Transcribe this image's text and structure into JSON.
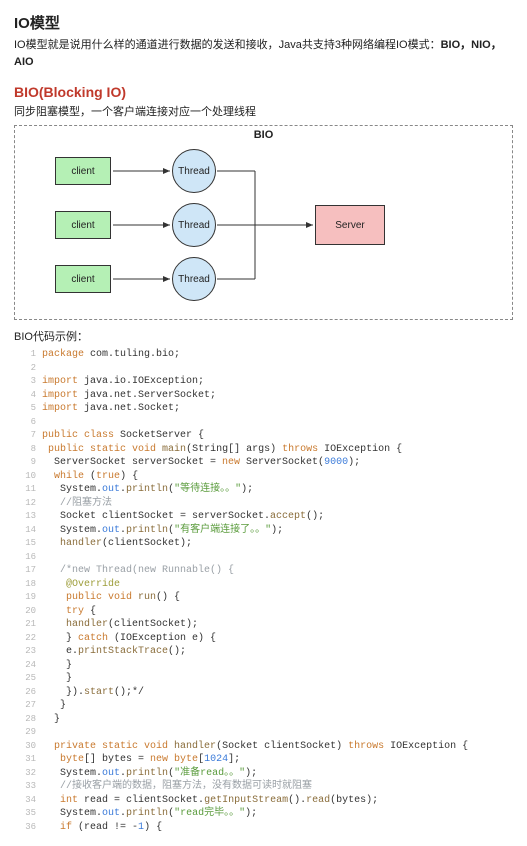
{
  "heading_io": "IO模型",
  "intro_pre": "IO模型就是说用什么样的通道进行数据的发送和接收，Java共支持3种网络编程IO模式：",
  "intro_bold": "BIO，NIO，AIO",
  "heading_bio": "BIO(Blocking IO)",
  "bio_desc": "同步阻塞模型，一个客户端连接对应一个处理线程",
  "diagram": {
    "title": "BIO",
    "client": "client",
    "thread": "Thread",
    "server": "Server"
  },
  "code_caption": "BIO代码示例：",
  "code": [
    {
      "n": 1,
      "seg": [
        {
          "c": "kw",
          "t": "package"
        },
        {
          "t": " com.tuling.bio;"
        }
      ]
    },
    {
      "n": 2,
      "seg": []
    },
    {
      "n": 3,
      "seg": [
        {
          "c": "kw",
          "t": "import"
        },
        {
          "t": " java.io.IOException;"
        }
      ]
    },
    {
      "n": 4,
      "seg": [
        {
          "c": "kw",
          "t": "import"
        },
        {
          "t": " java.net.ServerSocket;"
        }
      ]
    },
    {
      "n": 5,
      "seg": [
        {
          "c": "kw",
          "t": "import"
        },
        {
          "t": " java.net.Socket;"
        }
      ]
    },
    {
      "n": 6,
      "seg": []
    },
    {
      "n": 7,
      "seg": [
        {
          "c": "kw",
          "t": "public class "
        },
        {
          "c": "cls",
          "t": "SocketServer"
        },
        {
          "t": " {"
        }
      ]
    },
    {
      "n": 8,
      "seg": [
        {
          "t": " "
        },
        {
          "c": "kw",
          "t": "public static void "
        },
        {
          "c": "meth",
          "t": "main"
        },
        {
          "t": "(String[] args) "
        },
        {
          "c": "kw",
          "t": "throws"
        },
        {
          "t": " IOException {"
        }
      ]
    },
    {
      "n": 9,
      "seg": [
        {
          "t": "  ServerSocket serverSocket = "
        },
        {
          "c": "kw",
          "t": "new"
        },
        {
          "t": " ServerSocket("
        },
        {
          "c": "num",
          "t": "9000"
        },
        {
          "t": ");"
        }
      ]
    },
    {
      "n": 10,
      "seg": [
        {
          "t": "  "
        },
        {
          "c": "kw",
          "t": "while"
        },
        {
          "t": " ("
        },
        {
          "c": "kw",
          "t": "true"
        },
        {
          "t": ") {"
        }
      ]
    },
    {
      "n": 11,
      "seg": [
        {
          "t": "   System."
        },
        {
          "c": "blue",
          "t": "out"
        },
        {
          "t": "."
        },
        {
          "c": "meth",
          "t": "println"
        },
        {
          "t": "("
        },
        {
          "c": "str",
          "t": "\"等待连接。。\""
        },
        {
          "t": ");"
        }
      ]
    },
    {
      "n": 12,
      "seg": [
        {
          "t": "   "
        },
        {
          "c": "cmt",
          "t": "//阻塞方法"
        }
      ]
    },
    {
      "n": 13,
      "seg": [
        {
          "t": "   Socket clientSocket = serverSocket."
        },
        {
          "c": "meth",
          "t": "accept"
        },
        {
          "t": "();"
        }
      ]
    },
    {
      "n": 14,
      "seg": [
        {
          "t": "   System."
        },
        {
          "c": "blue",
          "t": "out"
        },
        {
          "t": "."
        },
        {
          "c": "meth",
          "t": "println"
        },
        {
          "t": "("
        },
        {
          "c": "str",
          "t": "\"有客户端连接了。。\""
        },
        {
          "t": ");"
        }
      ]
    },
    {
      "n": 15,
      "seg": [
        {
          "t": "   "
        },
        {
          "c": "meth",
          "t": "handler"
        },
        {
          "t": "(clientSocket);"
        }
      ]
    },
    {
      "n": 16,
      "seg": []
    },
    {
      "n": 17,
      "seg": [
        {
          "t": "   "
        },
        {
          "c": "cmt",
          "t": "/*new Thread(new Runnable() {"
        }
      ]
    },
    {
      "n": 18,
      "seg": [
        {
          "t": "    "
        },
        {
          "c": "ann",
          "t": "@Override"
        }
      ]
    },
    {
      "n": 19,
      "seg": [
        {
          "t": "    "
        },
        {
          "c": "kw",
          "t": "public void "
        },
        {
          "c": "meth",
          "t": "run"
        },
        {
          "t": "() {"
        }
      ]
    },
    {
      "n": 20,
      "seg": [
        {
          "t": "    "
        },
        {
          "c": "kw",
          "t": "try"
        },
        {
          "t": " {"
        }
      ]
    },
    {
      "n": 21,
      "seg": [
        {
          "t": "    "
        },
        {
          "c": "meth",
          "t": "handler"
        },
        {
          "t": "(clientSocket);"
        }
      ]
    },
    {
      "n": 22,
      "seg": [
        {
          "t": "    } "
        },
        {
          "c": "kw",
          "t": "catch"
        },
        {
          "t": " (IOException e) {"
        }
      ]
    },
    {
      "n": 23,
      "seg": [
        {
          "t": "    e."
        },
        {
          "c": "meth",
          "t": "printStackTrace"
        },
        {
          "t": "();"
        }
      ]
    },
    {
      "n": 24,
      "seg": [
        {
          "t": "    }"
        }
      ]
    },
    {
      "n": 25,
      "seg": [
        {
          "t": "    }"
        }
      ]
    },
    {
      "n": 26,
      "seg": [
        {
          "t": "    })."
        },
        {
          "c": "meth",
          "t": "start"
        },
        {
          "t": "();*/"
        }
      ]
    },
    {
      "n": 27,
      "seg": [
        {
          "t": "   }"
        }
      ]
    },
    {
      "n": 28,
      "seg": [
        {
          "t": "  }"
        }
      ]
    },
    {
      "n": 29,
      "seg": []
    },
    {
      "n": 30,
      "seg": [
        {
          "t": "  "
        },
        {
          "c": "kw",
          "t": "private static void "
        },
        {
          "c": "meth",
          "t": "handler"
        },
        {
          "t": "(Socket clientSocket) "
        },
        {
          "c": "kw",
          "t": "throws"
        },
        {
          "t": " IOException {"
        }
      ]
    },
    {
      "n": 31,
      "seg": [
        {
          "t": "   "
        },
        {
          "c": "kw",
          "t": "byte"
        },
        {
          "t": "[] bytes = "
        },
        {
          "c": "kw",
          "t": "new byte"
        },
        {
          "t": "["
        },
        {
          "c": "num",
          "t": "1024"
        },
        {
          "t": "];"
        }
      ]
    },
    {
      "n": 32,
      "seg": [
        {
          "t": "   System."
        },
        {
          "c": "blue",
          "t": "out"
        },
        {
          "t": "."
        },
        {
          "c": "meth",
          "t": "println"
        },
        {
          "t": "("
        },
        {
          "c": "str",
          "t": "\"准备read。。\""
        },
        {
          "t": ");"
        }
      ]
    },
    {
      "n": 33,
      "seg": [
        {
          "t": "   "
        },
        {
          "c": "cmt",
          "t": "//接收客户端的数据，阻塞方法，没有数据可读时就阻塞"
        }
      ]
    },
    {
      "n": 34,
      "seg": [
        {
          "t": "   "
        },
        {
          "c": "kw",
          "t": "int"
        },
        {
          "t": " read = clientSocket."
        },
        {
          "c": "meth",
          "t": "getInputStream"
        },
        {
          "t": "()."
        },
        {
          "c": "meth",
          "t": "read"
        },
        {
          "t": "(bytes);"
        }
      ]
    },
    {
      "n": 35,
      "seg": [
        {
          "t": "   System."
        },
        {
          "c": "blue",
          "t": "out"
        },
        {
          "t": "."
        },
        {
          "c": "meth",
          "t": "println"
        },
        {
          "t": "("
        },
        {
          "c": "str",
          "t": "\"read完毕。。\""
        },
        {
          "t": ");"
        }
      ]
    },
    {
      "n": 36,
      "seg": [
        {
          "t": "   "
        },
        {
          "c": "kw",
          "t": "if"
        },
        {
          "t": " (read != -"
        },
        {
          "c": "num",
          "t": "1"
        },
        {
          "t": ") {"
        }
      ]
    }
  ]
}
